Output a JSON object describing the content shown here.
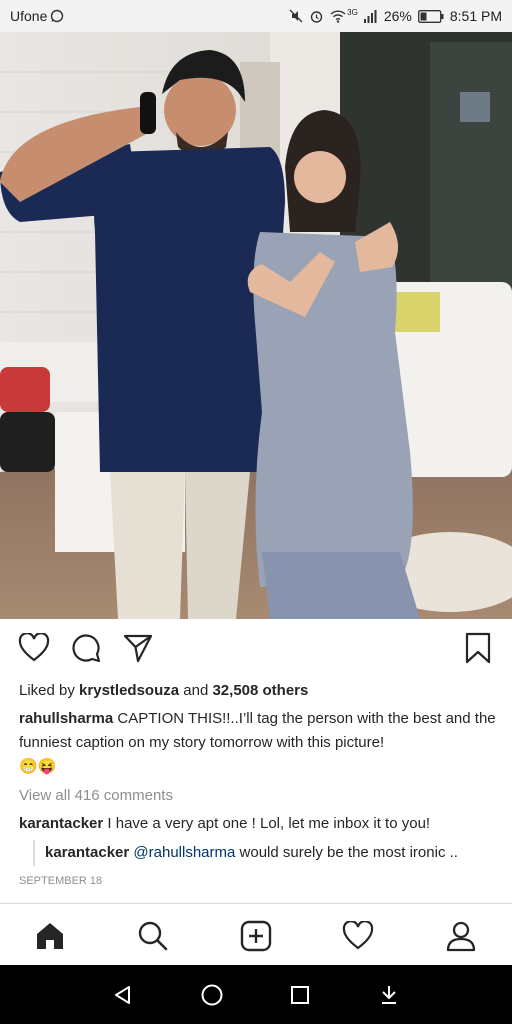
{
  "status_bar": {
    "carrier": "Ufone",
    "network": "3G",
    "battery": "26%",
    "time": "8:51 PM"
  },
  "post": {
    "liked_by_prefix": "Liked by",
    "liked_by_user": "krystledsouza",
    "liked_by_and": "and",
    "likes_count": "32,508 others",
    "author": "rahullsharma",
    "caption": "CAPTION THIS!!..I’ll tag the person with the best and the funniest caption on my story tomorrow with this picture!",
    "caption_emojis": "😁😝",
    "view_comments": "View all 416 comments",
    "comment1_user": "karantacker",
    "comment1_text": "I have a very apt one ! Lol, let me inbox it to you!",
    "reply_user": "karantacker",
    "reply_mention": "@rahullsharma",
    "reply_text": "would surely be the most ironic ..",
    "date": "SEPTEMBER 18"
  },
  "icons": {
    "like": "heart-icon",
    "comment": "comment-icon",
    "share": "share-icon",
    "save": "bookmark-icon",
    "nav": [
      "home-icon",
      "search-icon",
      "add-post-icon",
      "activity-heart-icon",
      "profile-icon"
    ]
  }
}
